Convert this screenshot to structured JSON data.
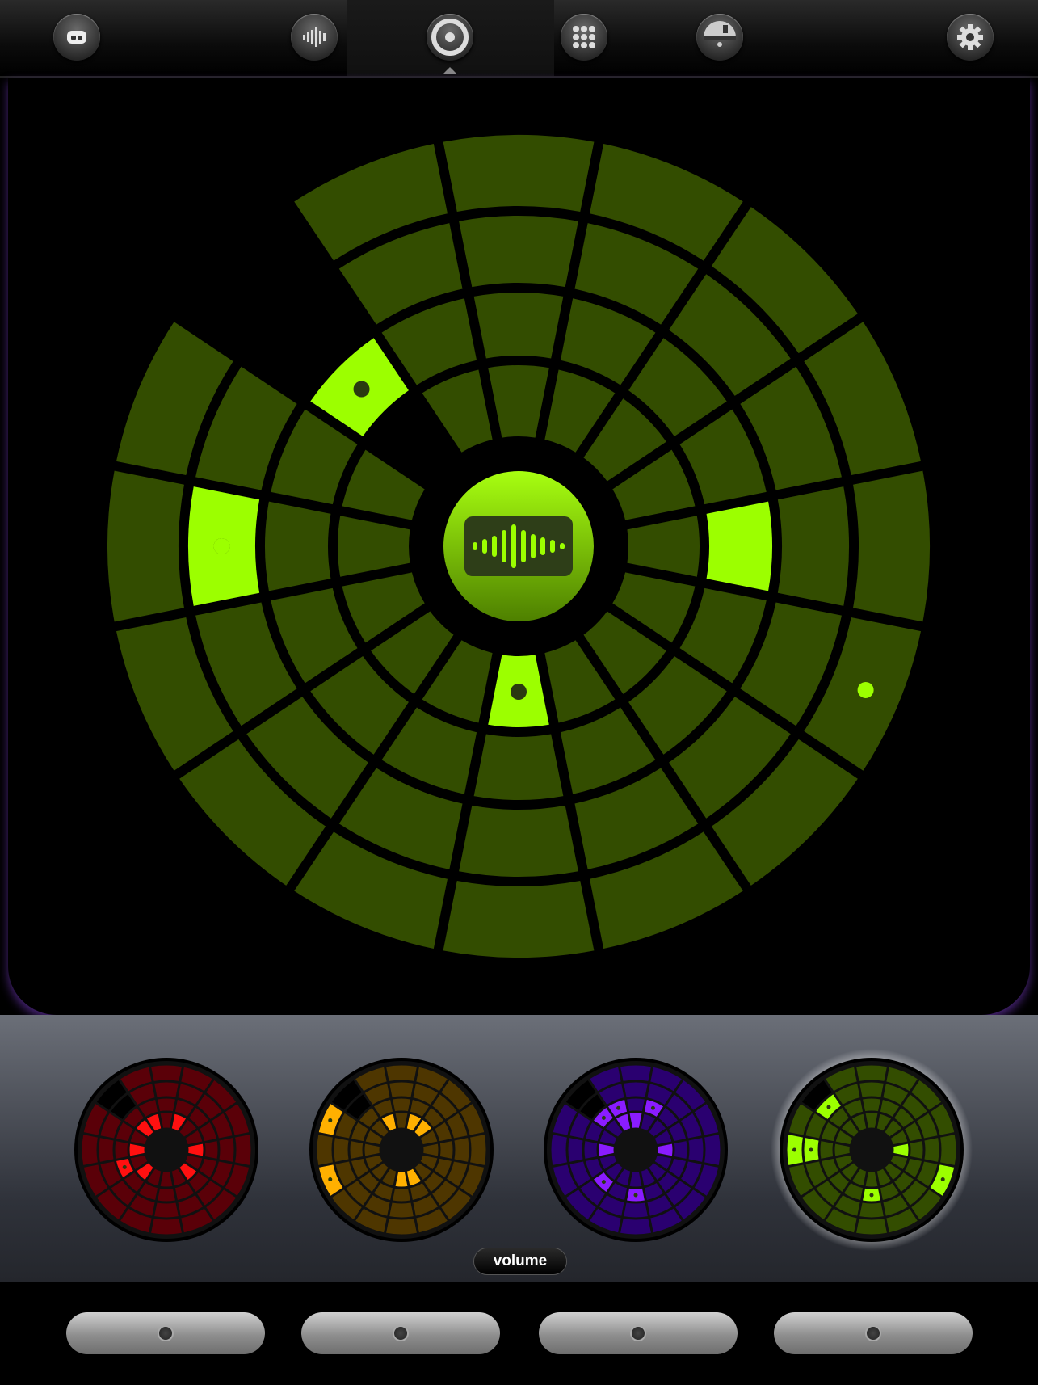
{
  "topbar": {
    "items": [
      {
        "name": "app-logo-button",
        "icon": "mask-icon"
      },
      {
        "name": "tab-sound",
        "icon": "waveform-icon"
      },
      {
        "name": "tab-loop",
        "icon": "ring-icon",
        "selected": true
      },
      {
        "name": "tab-grid",
        "icon": "grid-icon"
      },
      {
        "name": "tab-mixer",
        "icon": "mixer-icon"
      },
      {
        "name": "settings-button",
        "icon": "gear-icon"
      }
    ]
  },
  "main_loop": {
    "color": "#9cff00",
    "dim_color": "#334d00",
    "faded_color": "#4f6b2e",
    "center_icon": "waveform-icon",
    "active_cells": [
      {
        "ring": 2,
        "sector": 14,
        "dot": true
      },
      {
        "ring": 3,
        "sector": 12,
        "dot": true
      },
      {
        "ring": 2,
        "sector": 4,
        "dot": false
      },
      {
        "ring": 1,
        "sector": 8,
        "dot": true
      }
    ],
    "light_dots": [
      {
        "ring": 3,
        "sector": 12
      },
      {
        "ring": 4,
        "sector": 5
      }
    ],
    "faded_cells": [
      {
        "ring": 4,
        "sector": 14
      },
      {
        "ring": 3,
        "sector": 14
      },
      {
        "ring": 1,
        "sector": 14
      }
    ]
  },
  "loops": [
    {
      "name": "red",
      "color": "#ff1010",
      "dim": "#5a0008",
      "faded": "#7a3a3a",
      "selected": false
    },
    {
      "name": "orange",
      "color": "#ffb000",
      "dim": "#4e3600",
      "faded": "#6e5a30",
      "selected": false
    },
    {
      "name": "purple",
      "color": "#8a1cff",
      "dim": "#2a0070",
      "faded": "#4a3a78",
      "selected": false
    },
    {
      "name": "green",
      "color": "#9cff00",
      "dim": "#334d00",
      "faded": "#52703a",
      "selected": true
    }
  ],
  "volume_label": "volume",
  "bottom_buttons": 4
}
